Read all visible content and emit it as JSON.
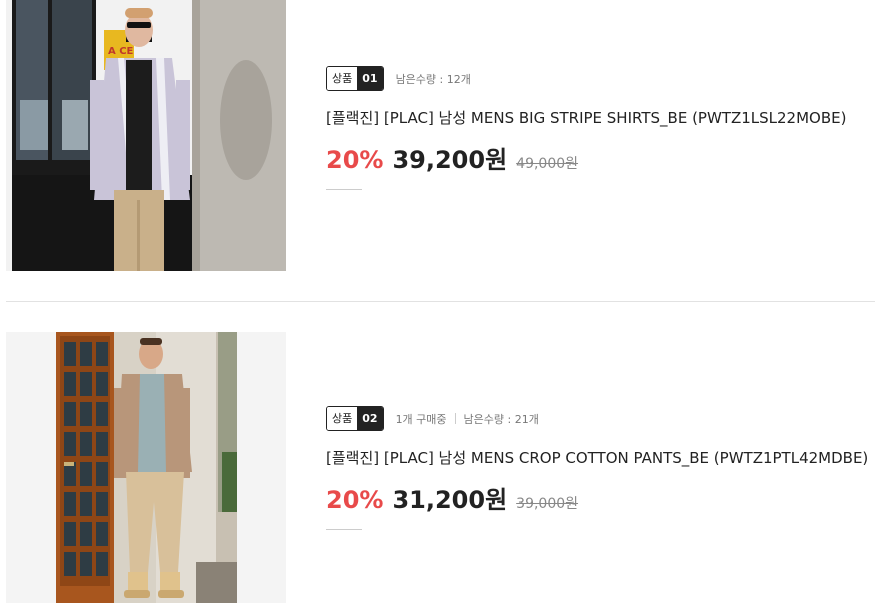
{
  "products": [
    {
      "tag_label": "상품",
      "tag_number": "01",
      "purchasing": "",
      "remaining": "남은수량 : 12개",
      "name": "[플랙진] [PLAC] 남성 MENS BIG STRIPE SHIRTS_BE (PWTZ1LSL22MOBE)",
      "discount_rate": "20%",
      "sale_price": "39,200원",
      "original_price": "49,000원",
      "image_sign": "A CE"
    },
    {
      "tag_label": "상품",
      "tag_number": "02",
      "purchasing": "1개 구매중",
      "remaining": "남은수량 : 21개",
      "name": "[플랙진] [PLAC] 남성 MENS CROP COTTON PANTS_BE (PWTZ1PTL42MDBE)",
      "discount_rate": "20%",
      "sale_price": "31,200원",
      "original_price": "39,000원"
    }
  ],
  "colors": {
    "accent_red": "#e84a4a",
    "text_dark": "#222222",
    "text_muted": "#888888",
    "divider": "#e2e2e2"
  }
}
